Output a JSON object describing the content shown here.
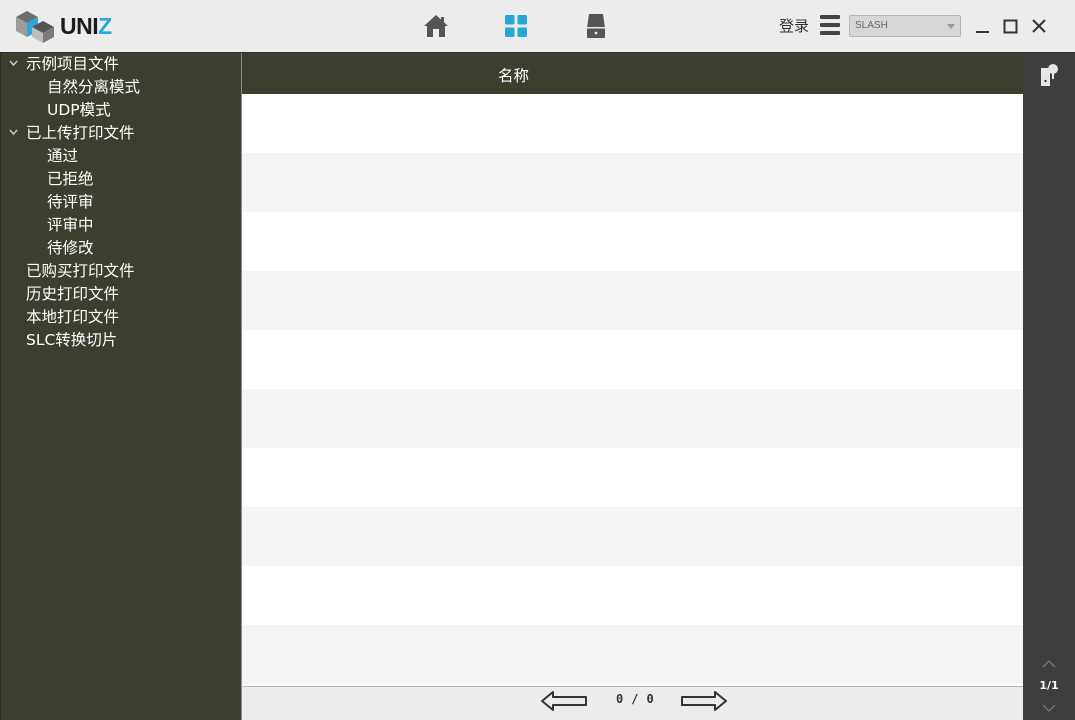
{
  "app": {
    "logo_text_main": "UNI",
    "logo_text_accent": "Z",
    "accent_color": "#2aa6d8",
    "sidebar_color": "#3e3e30"
  },
  "topnav": {
    "items": [
      {
        "icon": "home-icon",
        "active": false
      },
      {
        "icon": "grid-icon",
        "active": true
      },
      {
        "icon": "printer-device-icon",
        "active": false
      }
    ],
    "login_label": "登录",
    "printer_select": {
      "value": "SLASH"
    }
  },
  "sidebar": {
    "items": [
      {
        "label": "示例项目文件",
        "level": 0,
        "expanded": true
      },
      {
        "label": "自然分离模式",
        "level": 1
      },
      {
        "label": "UDP模式",
        "level": 1
      },
      {
        "label": "已上传打印文件",
        "level": 0,
        "expanded": true
      },
      {
        "label": "通过",
        "level": 1
      },
      {
        "label": "已拒绝",
        "level": 1
      },
      {
        "label": "待评审",
        "level": 1
      },
      {
        "label": "评审中",
        "level": 1
      },
      {
        "label": "待修改",
        "level": 1
      },
      {
        "label": "已购买打印文件",
        "level": 0
      },
      {
        "label": "历史打印文件",
        "level": 0
      },
      {
        "label": "本地打印文件",
        "level": 0
      },
      {
        "label": "SLC转换切片",
        "level": 0
      }
    ]
  },
  "table": {
    "columns": [
      "名称"
    ],
    "rows": []
  },
  "pager": {
    "current": "0",
    "separator": "/",
    "total": "0"
  },
  "rail": {
    "page_indicator": "1/1"
  }
}
